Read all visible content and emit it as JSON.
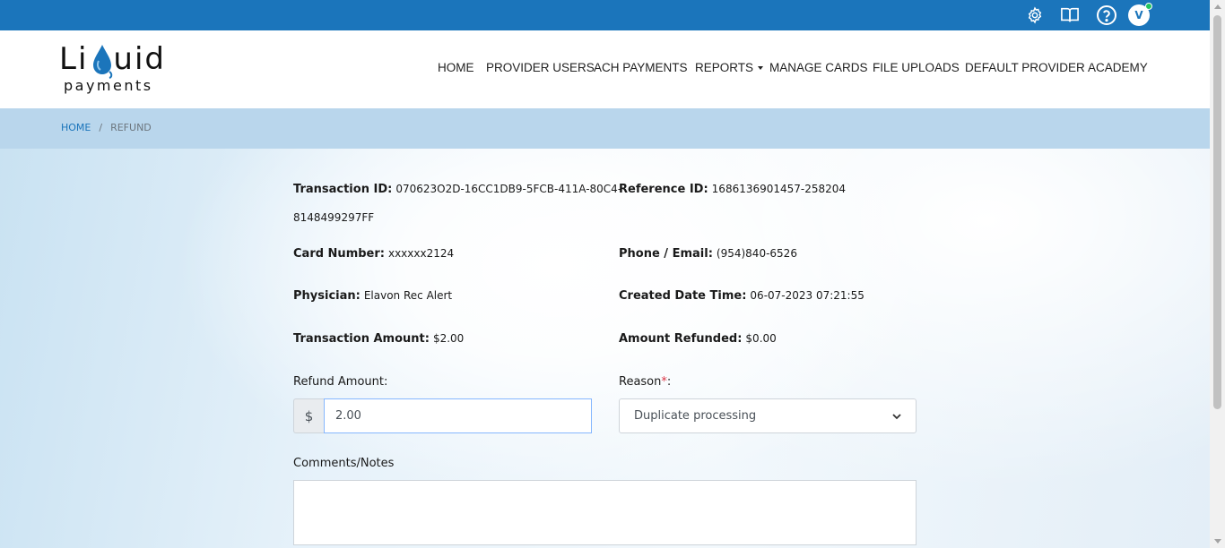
{
  "topbar": {
    "icons": [
      "gear-icon",
      "book-icon",
      "help-icon"
    ],
    "avatar_initial": "V",
    "colors": {
      "bar": "#1b75bb",
      "status_dot": "#22c55e"
    }
  },
  "brand": {
    "line1_a": "Li",
    "line1_b": "uid",
    "line2": "payments"
  },
  "nav": {
    "home": "HOME",
    "provider_users": "PROVIDER USERS",
    "ach_payments": "ACH PAYMENTS",
    "reports": "REPORTS",
    "manage_cards": "MANAGE CARDS",
    "file_uploads": "FILE UPLOADS",
    "default_provider": "DEFAULT PROVIDER",
    "academy": "ACADEMY"
  },
  "breadcrumb": {
    "home": "HOME",
    "separator": "/",
    "current": "REFUND"
  },
  "details": {
    "transaction_id_label": "Transaction ID:",
    "transaction_id_value_1": "070623O2D-16CC1DB9-5FCB-411A-80C4-",
    "transaction_id_value_2": "8148499297FF",
    "reference_id_label": "Reference ID:",
    "reference_id_value": "1686136901457-258204",
    "card_number_label": "Card Number:",
    "card_number_value": "xxxxxx2124",
    "phone_email_label": "Phone / Email:",
    "phone_email_value": "(954)840-6526",
    "physician_label": "Physician:",
    "physician_value": "Elavon Rec Alert",
    "created_label": "Created Date Time:",
    "created_value": "06-07-2023 07:21:55",
    "transaction_amount_label": "Transaction Amount:",
    "transaction_amount_value": "$2.00",
    "amount_refunded_label": "Amount Refunded:",
    "amount_refunded_value": "$0.00"
  },
  "form": {
    "refund_amount_label": "Refund Amount:",
    "currency_symbol": "$",
    "refund_amount_value": "2.00",
    "reason_label": "Reason",
    "reason_required_mark": "*",
    "reason_colon": ":",
    "reason_selected": "Duplicate processing",
    "comments_label": "Comments/Notes",
    "comments_value": ""
  }
}
